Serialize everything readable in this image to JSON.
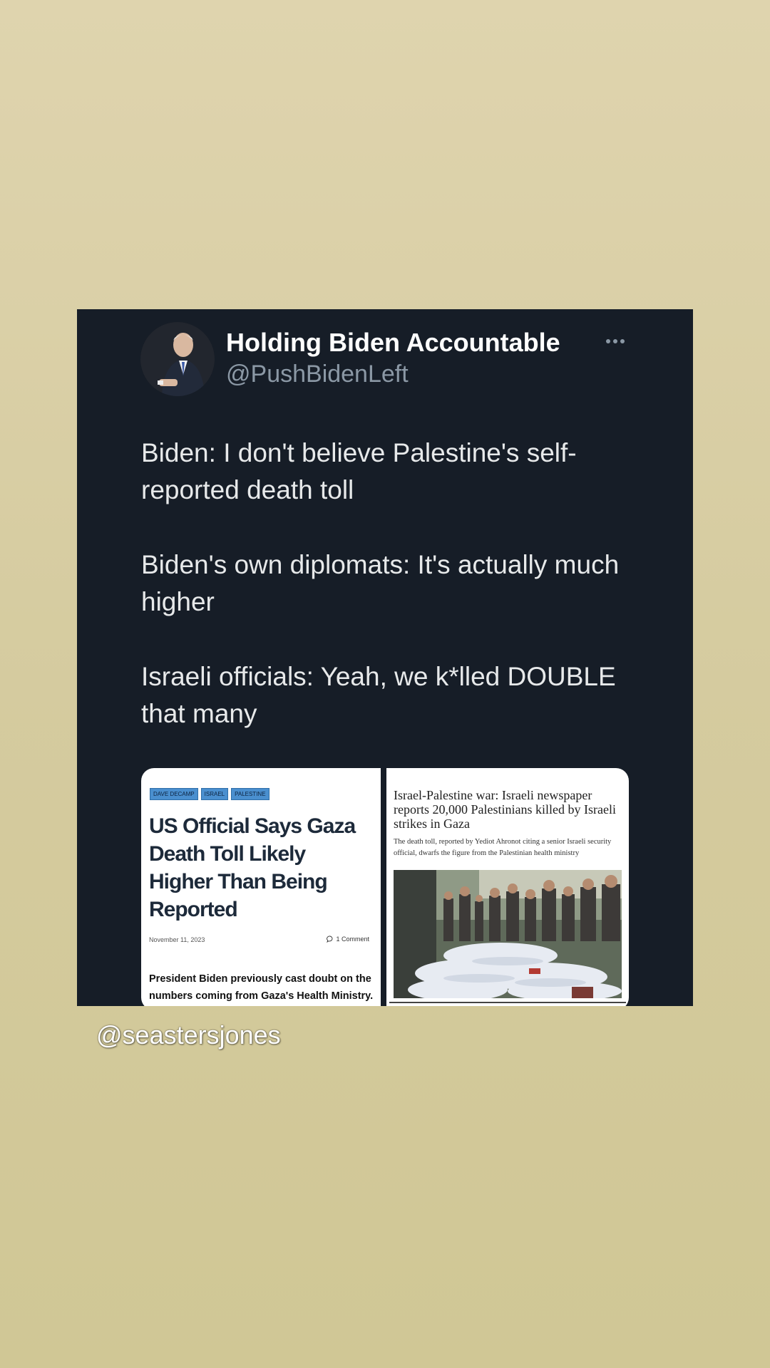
{
  "tweet": {
    "display_name": "Holding Biden Accountable",
    "handle": "@PushBidenLeft",
    "more_icon": "more-horizontal-icon",
    "paragraphs": [
      "Biden: I don't believe Palestine's self-reported death toll",
      "Biden's own diplomats: It's actually much higher",
      "Israeli officials: Yeah, we k*lled DOUBLE that many"
    ]
  },
  "article_left": {
    "tags": [
      "DAVE DECAMP",
      "ISRAEL",
      "PALESTINE"
    ],
    "headline": "US Official Says Gaza Death Toll Likely Higher Than Being Reported",
    "date": "November 11, 2023",
    "comments": "1 Comment",
    "summary": "President Biden previously cast doubt on the numbers coming from Gaza's Health Ministry."
  },
  "article_right": {
    "headline": "Israel-Palestine war: Israeli newspaper reports 20,000 Palestinians killed by Israeli strikes in Gaza",
    "dek": "The death toll, reported by Yediot Ahronot citing a senior Israeli security official, dwarfs the figure from the Palestinian health ministry"
  },
  "watermark": "@seastersjones",
  "colors": {
    "background": "#d8cea4",
    "card": "#161d27",
    "tag": "#4a8fcf"
  }
}
